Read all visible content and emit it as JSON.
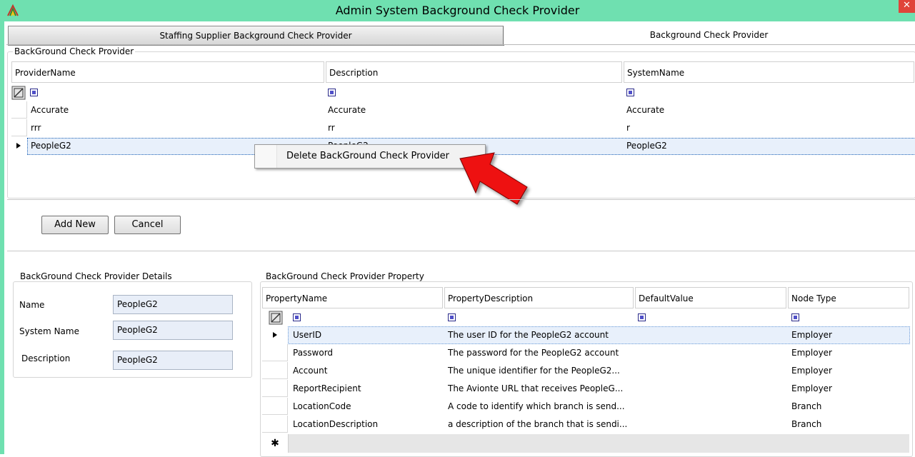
{
  "window": {
    "title": "Admin System Background Check Provider",
    "close_glyph": "✕"
  },
  "tabs": [
    {
      "label": "Staffing Supplier Background Check Provider"
    },
    {
      "label": "Background Check Provider"
    }
  ],
  "provider_group": {
    "label": "BackGround Check Provider",
    "columns": [
      "ProviderName",
      "Description",
      "SystemName"
    ],
    "rows": [
      {
        "provider_name": "Accurate",
        "description": "Accurate",
        "system_name": "Accurate"
      },
      {
        "provider_name": "rrr",
        "description": "rr",
        "system_name": "r"
      },
      {
        "provider_name": "PeopleG2",
        "description": "PeopleG2",
        "system_name": "PeopleG2"
      }
    ],
    "selected_row": 2
  },
  "context_menu": {
    "item": "Delete BackGround Check Provider"
  },
  "buttons": {
    "add_new": "Add New",
    "cancel": "Cancel"
  },
  "details": {
    "label": "BackGround Check Provider Details",
    "name_label": "Name",
    "name_value": "PeopleG2",
    "system_name_label": "System Name",
    "system_name_value": "PeopleG2",
    "description_label": "Description",
    "description_value": "PeopleG2"
  },
  "property_group": {
    "label": "BackGround Check Provider Property",
    "columns": [
      "PropertyName",
      "PropertyDescription",
      "DefaultValue",
      "Node Type"
    ],
    "rows": [
      {
        "name": "UserID",
        "description": "The user ID for the PeopleG2 account",
        "default": "",
        "node_type": "Employer"
      },
      {
        "name": "Password",
        "description": "The password for the PeopleG2 account",
        "default": "",
        "node_type": "Employer"
      },
      {
        "name": "Account",
        "description": "The unique identifier for the PeopleG2...",
        "default": "",
        "node_type": "Employer"
      },
      {
        "name": "ReportRecipient",
        "description": "The Avionte URL that receives PeopleG...",
        "default": "",
        "node_type": "Employer"
      },
      {
        "name": "LocationCode",
        "description": "A code to identify which branch is send...",
        "default": "",
        "node_type": "Branch"
      },
      {
        "name": "LocationDescription",
        "description": "a description of the branch that is sendi...",
        "default": "",
        "node_type": "Branch"
      }
    ],
    "new_row_glyph": "✱"
  },
  "colors": {
    "title_bar": "#6fe0b0",
    "arrow": "#ee1111",
    "selection": "#e8f0fb"
  },
  "icons": [
    "app-logo-icon",
    "close-icon",
    "filter-icon",
    "row-pointer-icon",
    "new-row-icon",
    "red-arrow-icon"
  ]
}
